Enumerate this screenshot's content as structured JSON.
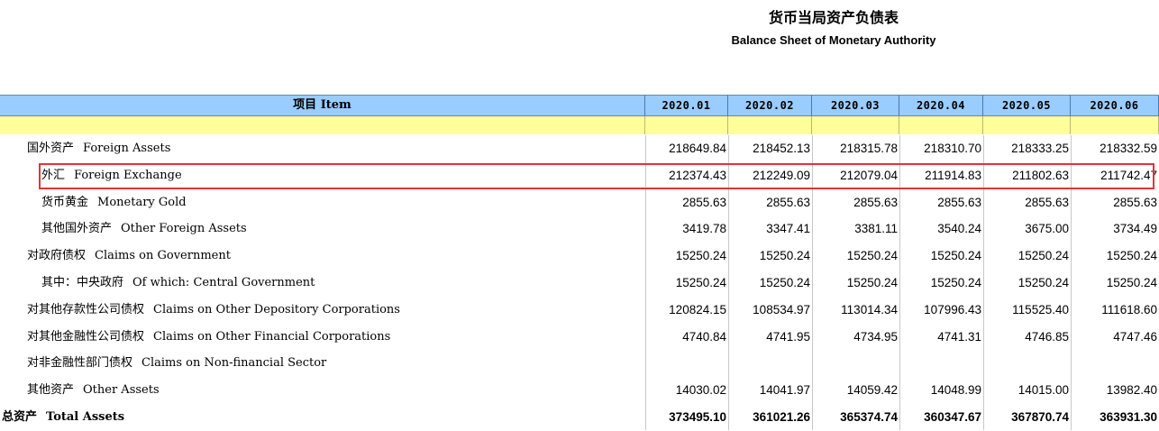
{
  "title_cn": "货币当局资产负债表",
  "title_en": "Balance Sheet of  Monetary Authority",
  "header": {
    "item_label": "项目 Item",
    "periods": [
      "2020.01",
      "2020.02",
      "2020.03",
      "2020.04",
      "2020.05",
      "2020.06"
    ]
  },
  "rows": [
    {
      "cn": "国外资产",
      "en": "Foreign Assets",
      "values": [
        "218649.84",
        "218452.13",
        "218315.78",
        "218310.70",
        "218333.25",
        "218332.59"
      ]
    },
    {
      "cn": "外汇",
      "en": "Foreign Exchange",
      "values": [
        "212374.43",
        "212249.09",
        "212079.04",
        "211914.83",
        "211802.63",
        "211742.47"
      ]
    },
    {
      "cn": "货币黄金",
      "en": "Monetary Gold",
      "values": [
        "2855.63",
        "2855.63",
        "2855.63",
        "2855.63",
        "2855.63",
        "2855.63"
      ]
    },
    {
      "cn": "其他国外资产",
      "en": "Other Foreign Assets",
      "values": [
        "3419.78",
        "3347.41",
        "3381.11",
        "3540.24",
        "3675.00",
        "3734.49"
      ]
    },
    {
      "cn": "对政府债权",
      "en": "Claims on Government",
      "values": [
        "15250.24",
        "15250.24",
        "15250.24",
        "15250.24",
        "15250.24",
        "15250.24"
      ]
    },
    {
      "cn": "其中：中央政府",
      "en": "Of which: Central Government",
      "values": [
        "15250.24",
        "15250.24",
        "15250.24",
        "15250.24",
        "15250.24",
        "15250.24"
      ]
    },
    {
      "cn": "对其他存款性公司债权",
      "en": "Claims on Other Depository Corporations",
      "values": [
        "120824.15",
        "108534.97",
        "113014.34",
        "107996.43",
        "115525.40",
        "111618.60"
      ]
    },
    {
      "cn": "对其他金融性公司债权",
      "en": "Claims on Other Financial Corporations",
      "values": [
        "4740.84",
        "4741.95",
        "4734.95",
        "4741.31",
        "4746.85",
        "4747.46"
      ]
    },
    {
      "cn": "对非金融性部门债权",
      "en": "Claims on Non-financial Sector",
      "values": [
        "",
        "",
        "",
        "",
        "",
        ""
      ]
    },
    {
      "cn": "其他资产",
      "en": "Other Assets",
      "values": [
        "14030.02",
        "14041.97",
        "14059.42",
        "14048.99",
        "14015.00",
        "13982.40"
      ]
    },
    {
      "cn": "总资产",
      "en": "Total Assets",
      "values": [
        "373495.10",
        "361021.26",
        "365374.74",
        "360347.67",
        "367870.74",
        "363931.30"
      ]
    }
  ]
}
